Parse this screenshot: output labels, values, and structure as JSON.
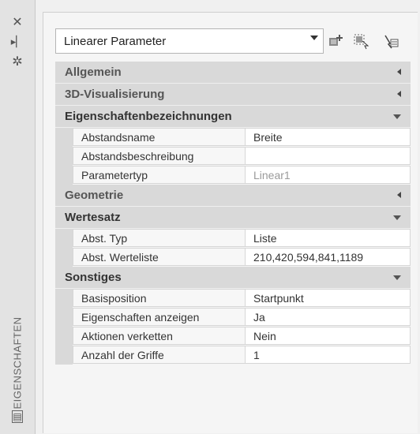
{
  "panel": {
    "vertical_title": "EIGENSCHAFTEN",
    "toolstrip_icons": [
      "close-icon",
      "pin-icon",
      "settings-icon",
      "properties-icon"
    ]
  },
  "selector": {
    "value": "Linearer Parameter",
    "icons": [
      "quick-select-icon",
      "select-objects-icon",
      "toggle-pickadd-icon"
    ]
  },
  "sections": [
    {
      "id": "allgemein",
      "title": "Allgemein",
      "expanded": false,
      "rows": []
    },
    {
      "id": "3d",
      "title": "3D-Visualisierung",
      "expanded": false,
      "rows": []
    },
    {
      "id": "eigenschaftenbezeichnungen",
      "title": "Eigenschaftenbezeichnungen",
      "expanded": true,
      "rows": [
        {
          "name": "Abstandsname",
          "value": "Breite",
          "disabled": false
        },
        {
          "name": "Abstandsbeschreibung",
          "value": "",
          "disabled": false
        },
        {
          "name": "Parametertyp",
          "value": "Linear1",
          "disabled": true
        }
      ]
    },
    {
      "id": "geometrie",
      "title": "Geometrie",
      "expanded": false,
      "rows": []
    },
    {
      "id": "wertesatz",
      "title": "Wertesatz",
      "expanded": true,
      "rows": [
        {
          "name": "Abst. Typ",
          "value": "Liste",
          "disabled": false
        },
        {
          "name": "Abst. Werteliste",
          "value": "210,420,594,841,1189",
          "disabled": false
        }
      ]
    },
    {
      "id": "sonstiges",
      "title": "Sonstiges",
      "expanded": true,
      "rows": [
        {
          "name": "Basisposition",
          "value": "Startpunkt",
          "disabled": false
        },
        {
          "name": "Eigenschaften anzeigen",
          "value": "Ja",
          "disabled": false
        },
        {
          "name": "Aktionen verketten",
          "value": "Nein",
          "disabled": false
        },
        {
          "name": "Anzahl der Griffe",
          "value": "1",
          "disabled": false
        }
      ]
    }
  ]
}
